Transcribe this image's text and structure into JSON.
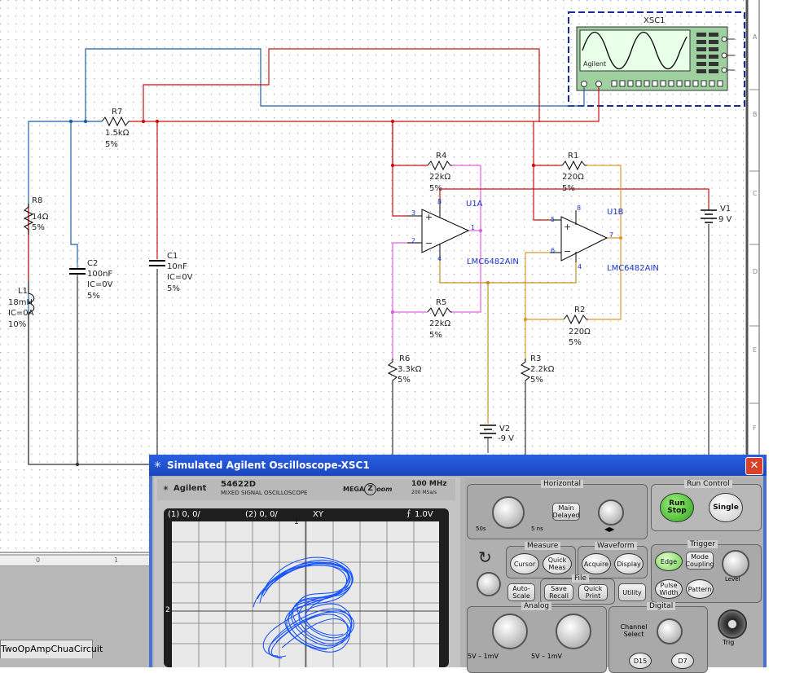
{
  "schematic": {
    "components": {
      "xsc1": "XSC1",
      "agilent_mini": "Agilent",
      "r7": {
        "name": "R7",
        "value": "1.5kΩ",
        "tol": "5%"
      },
      "r8": {
        "name": "R8",
        "value": "14Ω",
        "tol": "5%"
      },
      "l1": {
        "name": "L1",
        "value": "18mH",
        "ic": "IC=0A",
        "tol": "10%"
      },
      "c2": {
        "name": "C2",
        "value": "100nF",
        "ic": "IC=0V",
        "tol": "5%"
      },
      "c1": {
        "name": "C1",
        "value": "10nF",
        "ic": "IC=0V",
        "tol": "5%"
      },
      "r4": {
        "name": "R4",
        "value": "22kΩ",
        "tol": "5%"
      },
      "r5": {
        "name": "R5",
        "value": "22kΩ",
        "tol": "5%"
      },
      "r6": {
        "name": "R6",
        "value": "3.3kΩ",
        "tol": "5%"
      },
      "r1": {
        "name": "R1",
        "value": "220Ω",
        "tol": "5%"
      },
      "r2": {
        "name": "R2",
        "value": "220Ω",
        "tol": "5%"
      },
      "r3": {
        "name": "R3",
        "value": "2.2kΩ",
        "tol": "5%"
      },
      "u1a": {
        "name": "U1A",
        "part": "LMC6482AIN"
      },
      "u1b": {
        "name": "U1B",
        "part": "LMC6482AIN"
      },
      "v1": {
        "name": "V1",
        "value": "9 V"
      },
      "v2": {
        "name": "V2",
        "value": "-9 V"
      }
    },
    "pins": {
      "p8a": "8",
      "p3": "3",
      "p2": "2",
      "p1": "1",
      "p4a": "4",
      "p8b": "8",
      "p5": "5",
      "p6": "6",
      "p7": "7",
      "p4b": "4"
    },
    "border_rows": [
      "A",
      "B",
      "C",
      "D",
      "E",
      "F"
    ],
    "ruler_cols": [
      "0",
      "1"
    ]
  },
  "tab_label": "TwoOpAmpChuaCircuit",
  "oscilloscope_window": {
    "title": "Simulated Agilent Oscilloscope-XSC1",
    "close_glyph": "✕",
    "brand": "Agilent",
    "model": "54622D",
    "model_desc": "MIXED SIGNAL OSCILLOSCOPE",
    "megazoom": "MEGA",
    "megazoom2": "oom",
    "bandwidth": "100 MHz",
    "sample_rate": "200 MSa/s",
    "screen": {
      "ch1": "(1) 0, 0/",
      "ch2": "(2) 0, 0/",
      "mode": "XY",
      "trigger": "1.0V",
      "marker1": "1",
      "marker2": "2"
    },
    "horizontal": {
      "label": "Horizontal",
      "time1": "50s",
      "time2": "5 ns",
      "main_delayed": "Main Delayed"
    },
    "run_control": {
      "label": "Run Control",
      "run_stop": "Run Stop",
      "single": "Single"
    },
    "measure": {
      "label": "Measure",
      "cursor": "Cursor",
      "quick_meas": "Quick Meas"
    },
    "waveform": {
      "label": "Waveform",
      "acquire": "Acquire",
      "display": "Display"
    },
    "file": {
      "label": "File",
      "autoscale": "Auto-Scale",
      "save_recall": "Save Recall",
      "quick_print": "Quick Print",
      "utility": "Utility"
    },
    "trigger": {
      "label": "Trigger",
      "edge": "Edge",
      "mode_coupling": "Mode Coupling",
      "level": "Level",
      "pulse_width": "Pulse Width",
      "pattern": "Pattern",
      "trig": "Trig"
    },
    "analog": {
      "label": "Analog",
      "v1": "5V – 1mV",
      "v2": "5V – 1mV"
    },
    "digital": {
      "label": "Digital",
      "channel_select": "Channel Select",
      "d15": "D15",
      "d7": "D7"
    }
  },
  "colors": {
    "red_wire": "#cc1111",
    "blue_wire": "#1e5ea8",
    "magenta_wire": "#e060e0",
    "olive_wire": "#c09020",
    "orange_wire": "#d89a2a",
    "trace": "#1a55ff"
  }
}
